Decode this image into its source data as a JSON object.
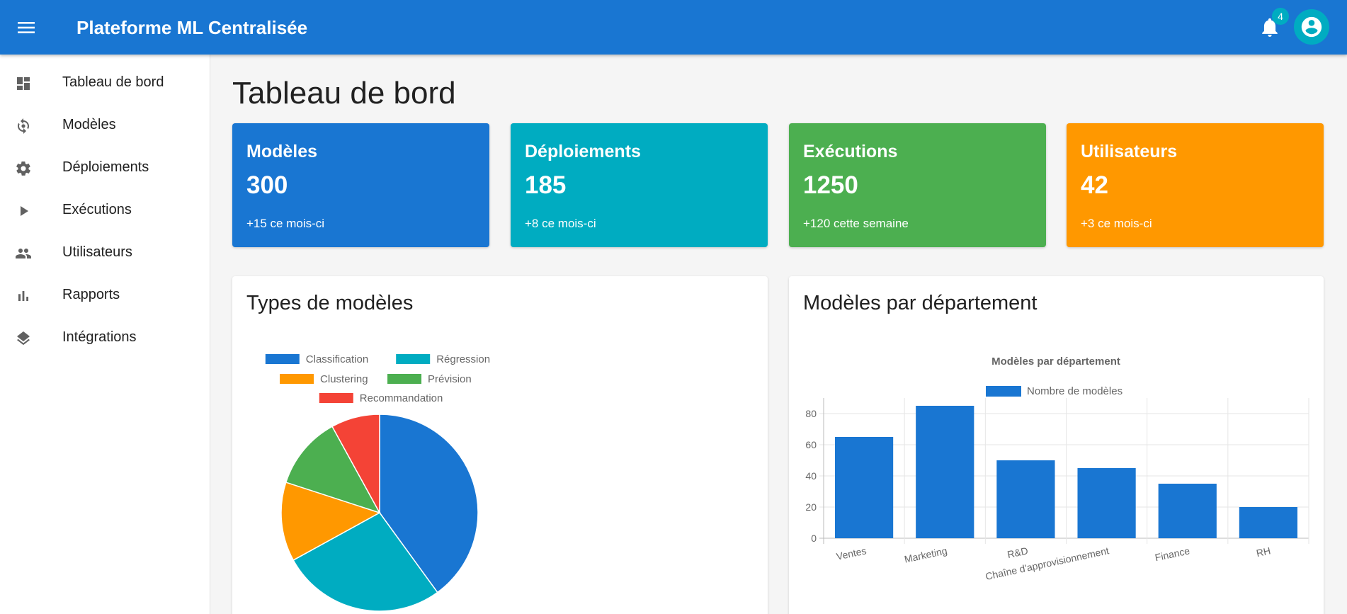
{
  "appbar": {
    "title": "Plateforme ML Centralisée",
    "menu_icon": "menu-icon",
    "notification_icon": "bell-icon",
    "notification_count": "4",
    "avatar_icon": "account-circle-icon"
  },
  "sidebar": {
    "items": [
      {
        "label": "Tableau de bord",
        "icon": "dashboard-icon"
      },
      {
        "label": "Modèles",
        "icon": "model-cycle-icon"
      },
      {
        "label": "Déploiements",
        "icon": "gear-icon"
      },
      {
        "label": "Exécutions",
        "icon": "play-icon"
      },
      {
        "label": "Utilisateurs",
        "icon": "people-icon"
      },
      {
        "label": "Rapports",
        "icon": "bar-chart-icon"
      },
      {
        "label": "Intégrations",
        "icon": "layers-icon"
      }
    ]
  },
  "page": {
    "title": "Tableau de bord"
  },
  "stats": [
    {
      "title": "Modèles",
      "value": "300",
      "sub": "+15 ce mois-ci",
      "color": "#1976d2"
    },
    {
      "title": "Déploiements",
      "value": "185",
      "sub": "+8 ce mois-ci",
      "color": "#00acc1"
    },
    {
      "title": "Exécutions",
      "value": "1250",
      "sub": "+120 cette semaine",
      "color": "#4caf50"
    },
    {
      "title": "Utilisateurs",
      "value": "42",
      "sub": "+3 ce mois-ci",
      "color": "#ff9800"
    }
  ],
  "panels": {
    "types_title": "Types de modèles",
    "dept_title": "Modèles par département"
  },
  "chart_data": [
    {
      "type": "pie",
      "legend_position": "top",
      "slices": [
        {
          "label": "Classification",
          "value": 40,
          "color": "#1976d2"
        },
        {
          "label": "Régression",
          "value": 27,
          "color": "#00acc1"
        },
        {
          "label": "Clustering",
          "value": 13,
          "color": "#ff9800"
        },
        {
          "label": "Prévision",
          "value": 12,
          "color": "#4caf50"
        },
        {
          "label": "Recommandation",
          "value": 8,
          "color": "#f44336"
        }
      ]
    },
    {
      "type": "bar",
      "title": "Modèles par département",
      "legend_position": "top",
      "categories": [
        "Ventes",
        "Marketing",
        "R&D",
        "Chaîne d'approvisionnement",
        "Finance",
        "RH"
      ],
      "series": [
        {
          "name": "Nombre de modèles",
          "values": [
            65,
            85,
            50,
            45,
            35,
            20
          ],
          "color": "#1976d2"
        }
      ],
      "ylim": [
        0,
        90
      ],
      "yticks": [
        0,
        20,
        40,
        60,
        80
      ],
      "grid": true
    }
  ]
}
